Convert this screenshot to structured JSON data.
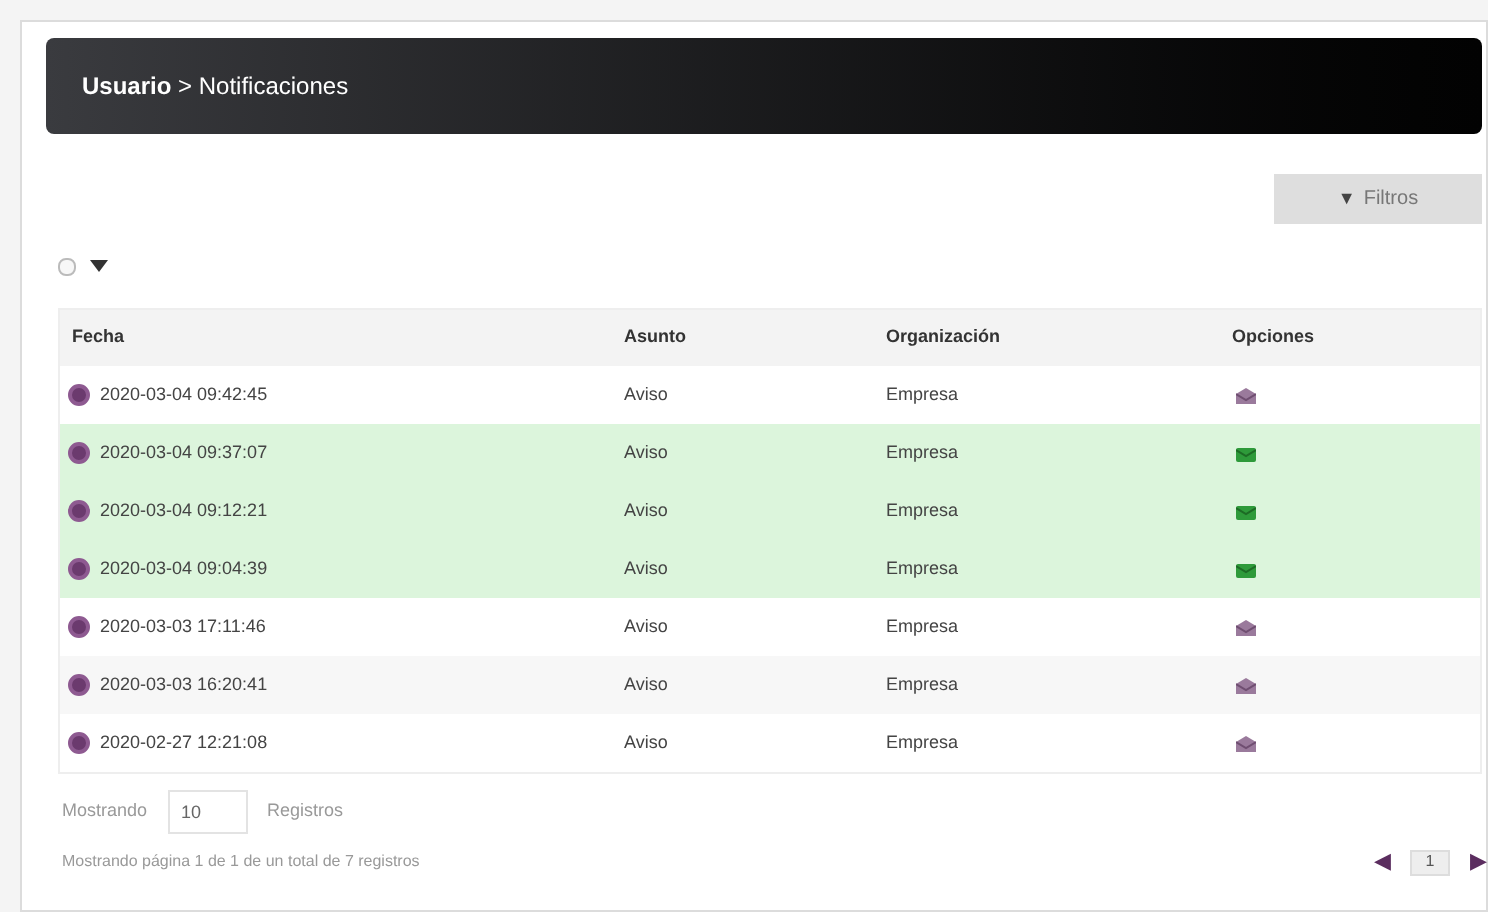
{
  "header": {
    "breadcrumb": "**Usuario** > Notificaciones"
  },
  "filters_button": {
    "icon": "▼",
    "label": "Filtros"
  },
  "select_all": {
    "checked": false
  },
  "table": {
    "columns": [
      "Fecha",
      "Asunto",
      "Organización",
      "Opciones"
    ],
    "rows": [
      {
        "fecha": "2020-03-04 09:42:45",
        "asunto": "Aviso",
        "organizacion": "Empresa",
        "unread": false
      },
      {
        "fecha": "2020-03-04 09:37:07",
        "asunto": "Aviso",
        "organizacion": "Empresa",
        "unread": true
      },
      {
        "fecha": "2020-03-04 09:12:21",
        "asunto": "Aviso",
        "organizacion": "Empresa",
        "unread": true
      },
      {
        "fecha": "2020-03-04 09:04:39",
        "asunto": "Aviso",
        "organizacion": "Empresa",
        "unread": true
      },
      {
        "fecha": "2020-03-03 17:11:46",
        "asunto": "Aviso",
        "organizacion": "Empresa",
        "unread": false
      },
      {
        "fecha": "2020-03-03 16:20:41",
        "asunto": "Aviso",
        "organizacion": "Empresa",
        "unread": false
      },
      {
        "fecha": "2020-02-27 12:21:08",
        "asunto": "Aviso",
        "organizacion": "Empresa",
        "unread": false
      }
    ]
  },
  "page_size": {
    "label_before": "Mostrando",
    "value": "10",
    "label_after": "Registros"
  },
  "summary": "Mostrando página 1 de 1 de un total de 7 registros",
  "pagination": {
    "prev": "◀",
    "page": "1",
    "next": "▶"
  }
}
